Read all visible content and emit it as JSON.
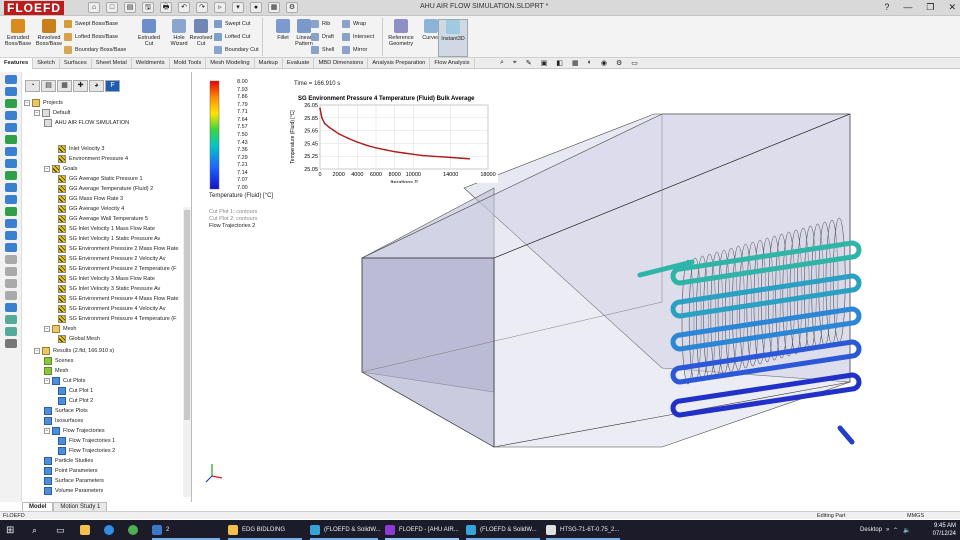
{
  "app": {
    "logo": "FLOEFD",
    "doc_title": "AHU AIR FLOW SIMULATION.SLDPRT *"
  },
  "qat": [
    "⌂",
    "□",
    "▤",
    "🖫",
    "🖶",
    "↶",
    "↷",
    "▹",
    "▾",
    "●",
    "▦",
    "⚙"
  ],
  "window_controls": [
    "?",
    "—",
    "❐",
    "✕"
  ],
  "ribbon": {
    "big": [
      {
        "label": "Extruded\nBoss/Base",
        "color": "#d98b1f"
      },
      {
        "label": "Revolved\nBoss/Base",
        "color": "#c97f1a"
      },
      {
        "label": "Extruded\nCut",
        "color": "#6b8fc6"
      },
      {
        "label": "Hole\nWizard",
        "color": "#8aa6cf"
      },
      {
        "label": "Revolved\nCut",
        "color": "#6e87b5"
      },
      {
        "label": "Fillet",
        "color": "#7c9ad0"
      },
      {
        "label": "Linear\nPattern",
        "color": "#7a98c9"
      },
      {
        "label": "Reference\nGeometry",
        "color": "#8f8fc7"
      },
      {
        "label": "Curves",
        "color": "#8db3d9"
      },
      {
        "label": "Instant3D",
        "color": "#9ecbe0"
      }
    ],
    "small": [
      {
        "label": "Swept Boss/Base",
        "color": "#d59a3a"
      },
      {
        "label": "Lofted Boss/Base",
        "color": "#d7a24a"
      },
      {
        "label": "Boundary Boss/Base",
        "color": "#d6a855"
      },
      {
        "label": "Swept Cut",
        "color": "#7d9cc8"
      },
      {
        "label": "Lofted Cut",
        "color": "#7f9fcb"
      },
      {
        "label": "Boundary Cut",
        "color": "#86a4cc"
      },
      {
        "label": "Rib",
        "color": "#8aa2c8"
      },
      {
        "label": "Draft",
        "color": "#8aa2c8"
      },
      {
        "label": "Shell",
        "color": "#8aa2c8"
      },
      {
        "label": "Wrap",
        "color": "#8aa2c8"
      },
      {
        "label": "Intersect",
        "color": "#8aa2c8"
      },
      {
        "label": "Mirror",
        "color": "#8aa2c8"
      }
    ]
  },
  "tabs": [
    "Features",
    "Sketch",
    "Surfaces",
    "Sheet Metal",
    "Weldments",
    "Mold Tools",
    "Mesh Modeling",
    "Markup",
    "Evaluate",
    "MBD Dimensions",
    "Analysis Preparation",
    "Flow Analysis"
  ],
  "active_tab": "Features",
  "panel_tabs": [
    "◔",
    "▤",
    "▦",
    "✚",
    "◕",
    "F"
  ],
  "tree": [
    {
      "label": "Projects",
      "icon": "fd",
      "indent": 0,
      "exp": "−"
    },
    {
      "label": "Default",
      "icon": "gy",
      "indent": 1,
      "exp": "−"
    },
    {
      "label": "AHU AIR FLOW SIMULATION",
      "icon": "gy",
      "indent": 2
    },
    {
      "label": "Inlet Velocity 3",
      "icon": "g",
      "indent": 3
    },
    {
      "label": "Environment Pressure 4",
      "icon": "g",
      "indent": 3
    },
    {
      "label": "Goals",
      "icon": "g",
      "indent": 2,
      "exp": "−"
    },
    {
      "label": "GG Average Static Pressure 1",
      "icon": "g",
      "indent": 3
    },
    {
      "label": "GG Average Temperature (Fluid) 2",
      "icon": "g",
      "indent": 3
    },
    {
      "label": "GG Mass Flow Rate 3",
      "icon": "g",
      "indent": 3
    },
    {
      "label": "GG Average Velocity 4",
      "icon": "g",
      "indent": 3
    },
    {
      "label": "GG Average Wall Temperature 5",
      "icon": "g",
      "indent": 3
    },
    {
      "label": "SG Inlet Velocity 1 Mass Flow Rate",
      "icon": "g",
      "indent": 3
    },
    {
      "label": "SG Inlet Velocity 1 Static Pressure Av",
      "icon": "g",
      "indent": 3
    },
    {
      "label": "SG Environment Pressure 2 Mass Flow Rate",
      "icon": "g",
      "indent": 3
    },
    {
      "label": "SG Environment Pressure 2 Velocity Av",
      "icon": "g",
      "indent": 3
    },
    {
      "label": "SG Environment Pressure 2 Temperature (F",
      "icon": "g",
      "indent": 3
    },
    {
      "label": "SG Inlet Velocity 3 Mass Flow Rate",
      "icon": "g",
      "indent": 3
    },
    {
      "label": "SG Inlet Velocity 3 Static Pressure Av",
      "icon": "g",
      "indent": 3
    },
    {
      "label": "SG Environment Pressure 4 Mass Flow Rate",
      "icon": "g",
      "indent": 3
    },
    {
      "label": "SG Environment Pressure 4 Velocity Av",
      "icon": "g",
      "indent": 3
    },
    {
      "label": "SG Environment Pressure 4 Temperature (F",
      "icon": "g",
      "indent": 3
    },
    {
      "label": "Mesh",
      "icon": "fd",
      "indent": 2,
      "exp": "−"
    },
    {
      "label": "Global Mesh",
      "icon": "g",
      "indent": 3
    },
    {
      "label": "Results (2.fld, 166.910 s)",
      "icon": "fd",
      "indent": 1,
      "exp": "−"
    },
    {
      "label": "Scenes",
      "icon": "gr",
      "indent": 2
    },
    {
      "label": "Mesh",
      "icon": "gr",
      "indent": 2
    },
    {
      "label": "Cut Plots",
      "icon": "b",
      "indent": 2,
      "exp": "−"
    },
    {
      "label": "Cut Plot 1",
      "icon": "b",
      "indent": 3
    },
    {
      "label": "Cut Plot 2",
      "icon": "b",
      "indent": 3
    },
    {
      "label": "Surface Plots",
      "icon": "b",
      "indent": 2
    },
    {
      "label": "Isosurfaces",
      "icon": "b",
      "indent": 2
    },
    {
      "label": "Flow Trajectories",
      "icon": "b",
      "indent": 2,
      "exp": "−"
    },
    {
      "label": "Flow Trajectories 1",
      "icon": "b",
      "indent": 3
    },
    {
      "label": "Flow Trajectories 2",
      "icon": "b",
      "indent": 3
    },
    {
      "label": "Particle Studies",
      "icon": "b",
      "indent": 2
    },
    {
      "label": "Point Parameters",
      "icon": "b",
      "indent": 2
    },
    {
      "label": "Surface Parameters",
      "icon": "b",
      "indent": 2
    },
    {
      "label": "Volume Parameters",
      "icon": "b",
      "indent": 2
    }
  ],
  "viewport": {
    "time_label": "Time = 166.910 s",
    "legend_title": "Temperature (Fluid) [°C]",
    "legend_values": [
      "8.00",
      "7.93",
      "7.86",
      "7.79",
      "7.71",
      "7.64",
      "7.57",
      "7.50",
      "7.43",
      "7.36",
      "7.29",
      "7.21",
      "7.14",
      "7.07",
      "7.00"
    ],
    "cut_plot_1": "Cut Plot 1: contours",
    "cut_plot_2": "Cut Plot 2: contours",
    "flow_traj": "Flow Trajectories 2"
  },
  "chart_data": {
    "type": "line",
    "title": "SG Environment Pressure 4 Temperature (Fluid) Bulk Average",
    "xlabel": "Iterations []",
    "ylabel": "Temperature (Fluid) [°C]",
    "xlim": [
      0,
      18000
    ],
    "ylim": [
      25.05,
      26.05
    ],
    "xticks": [
      0,
      2000,
      4000,
      6000,
      8000,
      10000,
      14000,
      18000
    ],
    "yticks": [
      25.05,
      25.25,
      25.45,
      25.65,
      25.85,
      26.05
    ],
    "series": [
      {
        "x": [
          0,
          200,
          500,
          1000,
          1500,
          2000,
          3000,
          4000,
          5000,
          6000,
          7000,
          8000,
          9000,
          10000,
          11000,
          12000,
          13000,
          14000,
          15000,
          16000
        ],
        "y": [
          26.0,
          25.85,
          25.76,
          25.7,
          25.65,
          25.6,
          25.53,
          25.47,
          25.42,
          25.38,
          25.35,
          25.32,
          25.3,
          25.28,
          25.26,
          25.25,
          25.24,
          25.23,
          25.22,
          25.21
        ]
      }
    ],
    "color": "#b01818"
  },
  "bottom_tabs": [
    "Model",
    "Motion Study 1"
  ],
  "status": {
    "left": "FLOEFD",
    "editing": "Editing Part",
    "units": "MMGS"
  },
  "taskbar": {
    "items": [
      "2",
      "EDG BIDLDING",
      "(FLOEFD & SolidW...",
      "FLOEFD - [AHU AIR...",
      "(FLOEFD & SolidW...",
      "HTSG-71-6T-0.75_2..."
    ],
    "desktop": "Desktop",
    "time": "9:45 AM",
    "date": "07/12/24"
  }
}
